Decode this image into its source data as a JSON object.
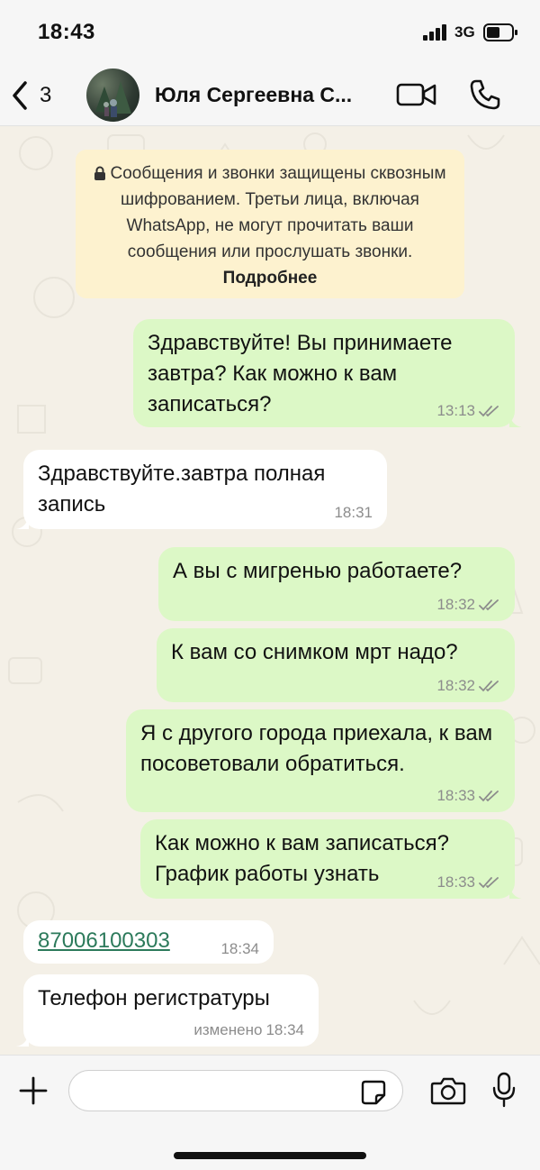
{
  "status_bar": {
    "time": "18:43",
    "network": "3G",
    "icons": [
      "signal-icon",
      "battery-icon"
    ]
  },
  "header": {
    "back_count": "3",
    "contact_name": "Юля Сергеевна С...",
    "icons": [
      "chevron-left-icon",
      "video-call-icon",
      "phone-icon"
    ]
  },
  "encryption_notice": {
    "text": "Сообщения и звонки защищены сквозным шифрованием. Третьи лица, включая WhatsApp, не могут прочитать ваши сообщения или прослушать звонки.",
    "learn_more": "Подробнее",
    "icon": "lock-icon"
  },
  "messages": [
    {
      "direction": "out",
      "text": "Здравствуйте! Вы принимаете завтра? Как можно к вам записаться?",
      "time": "13:13",
      "status": "read"
    },
    {
      "direction": "in",
      "text": "Здравствуйте.завтра полная запись",
      "time": "18:31"
    },
    {
      "direction": "out",
      "text": "А вы с мигренью работаете?",
      "time": "18:32",
      "status": "read"
    },
    {
      "direction": "out",
      "text": "К вам со снимком мрт надо?",
      "time": "18:32",
      "status": "read"
    },
    {
      "direction": "out",
      "text": "Я с другого города приехала, к вам посоветовали обратиться.",
      "time": "18:33",
      "status": "read"
    },
    {
      "direction": "out",
      "text": "Как можно к вам записаться? График работы узнать",
      "time": "18:33",
      "status": "read"
    },
    {
      "direction": "in",
      "text": "87006100303",
      "time": "18:34",
      "is_phone_link": true
    },
    {
      "direction": "in",
      "text": "Телефон регистратуры",
      "time": "18:34",
      "edited_label": "изменено"
    }
  ],
  "input_bar": {
    "placeholder": "",
    "icons": [
      "plus-icon",
      "sticker-icon",
      "camera-icon",
      "microphone-icon"
    ]
  },
  "colors": {
    "outgoing_bubble": "#dcf8c6",
    "incoming_bubble": "#ffffff",
    "notice_bg": "#fdf2cf",
    "chat_bg": "#f4f0e7",
    "link": "#2c7a5b"
  }
}
